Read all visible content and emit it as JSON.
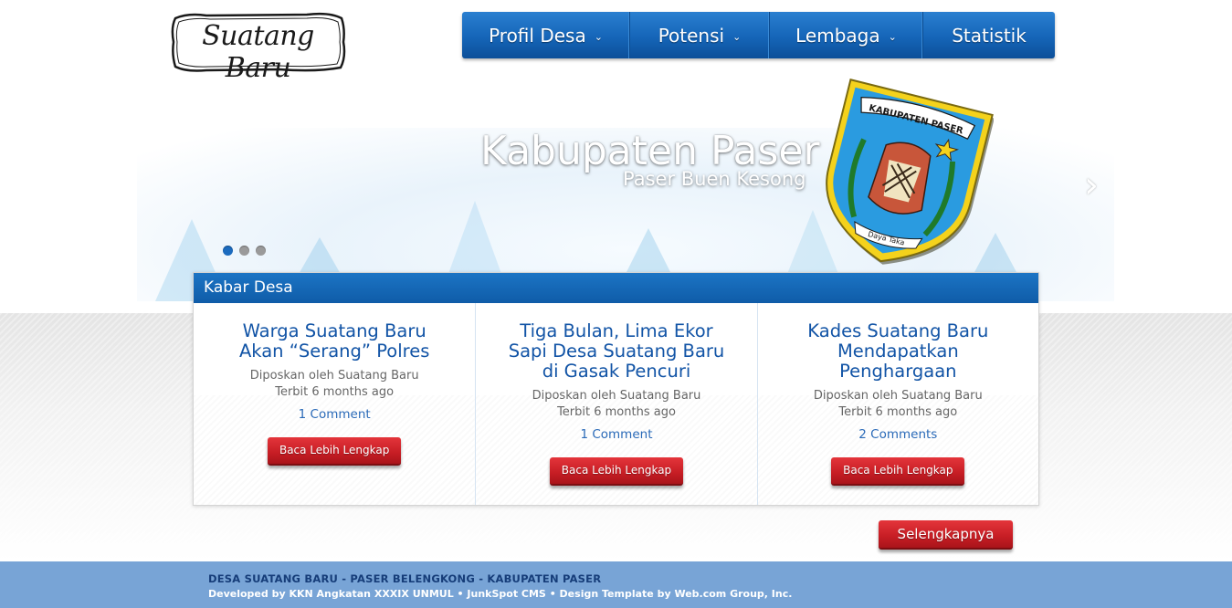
{
  "logo": {
    "text": "Suatang Baru"
  },
  "nav": {
    "items": [
      {
        "label": "Profil Desa",
        "dropdown": true
      },
      {
        "label": "Potensi",
        "dropdown": true
      },
      {
        "label": "Lembaga",
        "dropdown": true
      },
      {
        "label": "Statistik",
        "dropdown": false
      }
    ],
    "chevron": "⌄"
  },
  "slider": {
    "title": "Kabupaten Paser",
    "subtitle": "Paser Buen Kesong",
    "crest": {
      "banner_text": "KABUPATEN PASER",
      "motto_text": "Daya Taka"
    },
    "slide_count": 3,
    "active_slide": 1,
    "next_icon": "chevron-right"
  },
  "news": {
    "header": "Kabar Desa",
    "posts": [
      {
        "title": "Warga Suatang Baru Akan “Serang” Polres",
        "author": "Diposkan oleh Suatang Baru",
        "published": "Terbit 6 months ago",
        "comments": "1 Comment",
        "button": "Baca Lebih Lengkap"
      },
      {
        "title": "Tiga Bulan, Lima Ekor Sapi Desa Suatang Baru di Gasak Pencuri",
        "author": "Diposkan oleh Suatang Baru",
        "published": "Terbit 6 months ago",
        "comments": "1 Comment",
        "button": "Baca Lebih Lengkap"
      },
      {
        "title": "Kades Suatang Baru Mendapatkan Penghargaan",
        "author": "Diposkan oleh Suatang Baru",
        "published": "Terbit 6 months ago",
        "comments": "2 Comments",
        "button": "Baca Lebih Lengkap"
      }
    ],
    "more_button": "Selengkapnya"
  },
  "footer": {
    "line1": "DESA SUATANG BARU - PASER BELENGKONG - KABUPATEN PASER",
    "line2": "Developed by KKN Angkatan XXXIX UNMUL • JunkSpot CMS • Design Template by Web.com Group, Inc."
  },
  "colors": {
    "nav_blue": "#1565b8",
    "header_blue": "#1c74c4",
    "link_blue": "#1254a6",
    "button_red": "#c61d24",
    "footer_blue": "#78a4d6",
    "footer_dark": "#163d79"
  }
}
